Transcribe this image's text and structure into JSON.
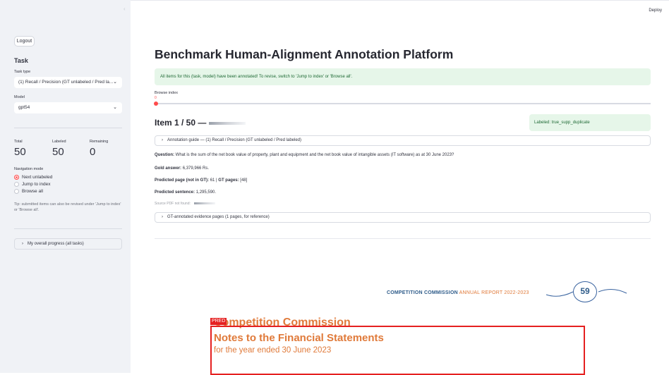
{
  "header": {
    "deploy_label": "Deploy"
  },
  "sidebar": {
    "logout_label": "Logout",
    "section_title": "Task",
    "task_type_label": "Task type",
    "task_type_value": "(1) Recall / Precision (GT unlabeled / Pred la...",
    "model_label": "Model",
    "model_value": "gpt54",
    "metrics": [
      {
        "label": "Total",
        "value": "50"
      },
      {
        "label": "Labeled",
        "value": "50"
      },
      {
        "label": "Remaining",
        "value": "0"
      }
    ],
    "nav_label": "Navigation mode",
    "nav_options": [
      {
        "label": "Next unlabeled",
        "selected": true
      },
      {
        "label": "Jump to index",
        "selected": false
      },
      {
        "label": "Browse all",
        "selected": false
      }
    ],
    "tip": "Tip: submitted items can also be revised under 'Jump to index' or 'Browse all'.",
    "progress_expander": "My overall progress (all tasks)"
  },
  "main": {
    "title": "Benchmark Human-Alignment Annotation Platform",
    "alert": "All items for this (task, model) have been annotated! To revise, switch to 'Jump to index' or 'Browse all'.",
    "browse_label": "Browse index",
    "browse_value": "0",
    "browse_fraction": 0,
    "item_title": "Item 1 / 50 —",
    "labeled_badge": "Labeled: true_supp_duplicate",
    "guide_expander": "Annotation guide — (1) Recall / Precision (GT unlabeled / Pred labeled)",
    "question_label": "Question:",
    "question_text": "What is the sum of the net book value of property, plant and equipment and the net book value of intangible assets (IT software) as at 30 June 2023?",
    "gold_label": "Gold answer:",
    "gold_text": "6,379,966 Rs.",
    "pred_page_label": "Predicted page (not in GT):",
    "pred_page_text": "61",
    "gt_pages_label": "GT pages:",
    "gt_pages_text": "[48]",
    "pred_sentence_label": "Predicted sentence:",
    "pred_sentence_text": "1,295,590.",
    "source_pdf": "Source PDF not found:",
    "gt_expander": "GT-annotated evidence pages (1 pages, for reference)"
  },
  "pdf": {
    "header_org": "COMPETITION COMMISSION",
    "header_report": "ANNUAL REPORT 2022-2023",
    "page_number": "59",
    "pred_tag": "PRED",
    "heading1": "Competition Commission",
    "heading2": "Notes to the Financial Statements",
    "subheading": "for the year ended 30 June 2023"
  },
  "colors": {
    "accent": "#ff4b4b",
    "success_bg": "#e6f6e9",
    "pred_box": "#e52020",
    "report_orange": "#e07a3a",
    "report_blue": "#2f5c8a"
  }
}
